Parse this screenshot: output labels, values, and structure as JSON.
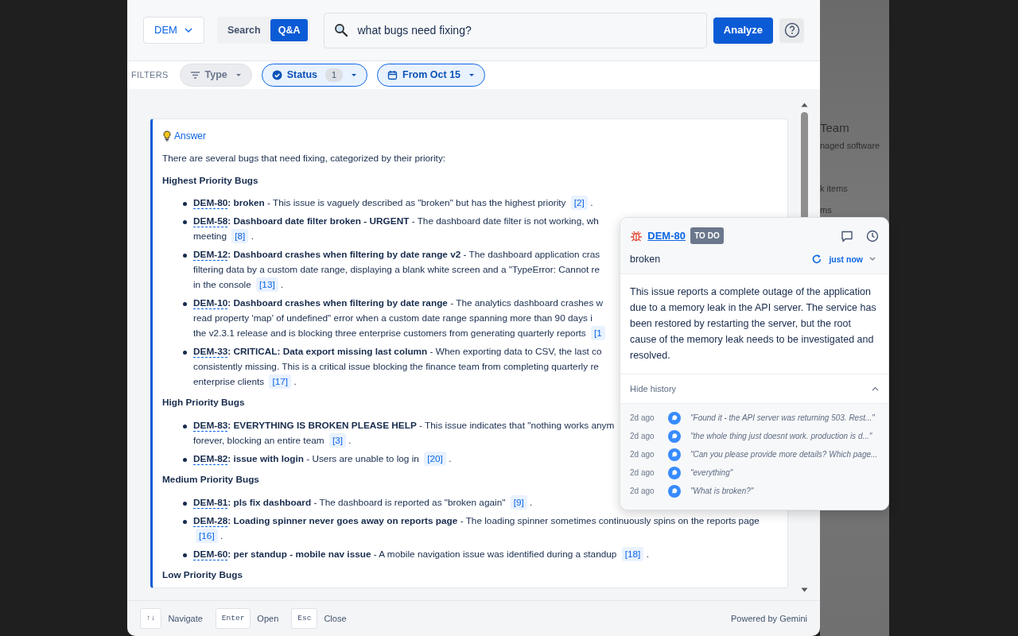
{
  "header": {
    "project": "DEM",
    "modes": [
      {
        "label": "Search",
        "selected": false
      },
      {
        "label": "Q&A",
        "selected": true
      }
    ],
    "query": "what bugs need fixing?",
    "analyze": "Analyze"
  },
  "filters": {
    "label": "FILTERS",
    "chips": [
      {
        "label": "Type",
        "active": false,
        "kind": "type"
      },
      {
        "label": "Status",
        "active": true,
        "kind": "status",
        "count": "1"
      },
      {
        "label": "From Oct 15",
        "active": true,
        "kind": "date"
      }
    ]
  },
  "answer": {
    "title": "Answer",
    "intro": "There are several bugs that need fixing, categorized by their priority:",
    "sections": [
      {
        "heading": "Highest Priority Bugs",
        "items": [
          {
            "id": "DEM-80",
            "title": ": broken",
            "lines": [
              "- This issue is vaguely described as \"broken\" but has the highest priority"
            ],
            "ref": "[2]",
            "end": "."
          },
          {
            "id": "DEM-58",
            "title": ": Dashboard date filter broken - URGENT",
            "lines": [
              "- The dashboard date filter is not working, wh",
              "meeting"
            ],
            "ref": "[8]",
            "end": "."
          },
          {
            "id": "DEM-12",
            "title": ": Dashboard crashes when filtering by date range v2",
            "lines": [
              "- The dashboard application cras",
              "filtering data by a custom date range, displaying a blank white screen and a \"TypeError: Cannot re",
              "in the console"
            ],
            "ref": "[13]",
            "end": "."
          },
          {
            "id": "DEM-10",
            "title": ": Dashboard crashes when filtering by date range",
            "lines": [
              "- The analytics dashboard crashes w",
              "read property 'map' of undefined\" error when a custom date range spanning more than 90 days i",
              "the v2.3.1 release and is blocking three enterprise customers from generating quarterly reports"
            ],
            "ref": "[1"
          },
          {
            "id": "DEM-33",
            "title": ": CRITICAL: Data export missing last column",
            "lines": [
              "- When exporting data to CSV, the last co",
              "consistently missing. This is a critical issue blocking the finance team from completing quarterly re",
              "enterprise clients"
            ],
            "ref": "[17]",
            "end": "."
          }
        ]
      },
      {
        "heading": "High Priority Bugs",
        "items": [
          {
            "id": "DEM-83",
            "title": ": EVERYTHING IS BROKEN PLEASE HELP",
            "lines": [
              "- This issue indicates that \"nothing works anym",
              "forever, blocking an entire team"
            ],
            "ref": "[3]",
            "end": "."
          },
          {
            "id": "DEM-82",
            "title": ": issue with login",
            "lines": [
              "- Users are unable to log in"
            ],
            "ref": "[20]",
            "end": "."
          }
        ]
      },
      {
        "heading": "Medium Priority Bugs",
        "items": [
          {
            "id": "DEM-81",
            "title": ": pls fix dashboard",
            "lines": [
              "- The dashboard is reported as \"broken again\""
            ],
            "ref": "[9]",
            "end": "."
          },
          {
            "id": "DEM-28",
            "title": ": Loading spinner never goes away on reports page",
            "lines": [
              "- The loading spinner sometimes continuously spins on the reports page"
            ],
            "ref": "[16]",
            "end": "."
          },
          {
            "id": "DEM-60",
            "title": ": per standup - mobile nav issue",
            "lines": [
              "- A mobile navigation issue was identified during a standup"
            ],
            "ref": "[18]",
            "end": "."
          }
        ]
      },
      {
        "heading": "Low Priority Bugs"
      }
    ]
  },
  "popover": {
    "key": "DEM-80",
    "status": "TO DO",
    "summary": "broken",
    "updated": "just now",
    "description": "This issue reports a complete outage of the application due to a memory leak in the API server. The service has been restored by restarting the server, but the root cause of the memory leak needs to be investigated and resolved.",
    "history_toggle": "Hide history",
    "expanded": true,
    "history": [
      {
        "time": "2d ago",
        "text": "\"Found it - the API server was returning 503. Rest...\""
      },
      {
        "time": "2d ago",
        "text": "\"the whole thing just doesnt work. production is d...\""
      },
      {
        "time": "2d ago",
        "text": "\"Can you please provide more details? Which page..."
      },
      {
        "time": "2d ago",
        "text": "\"everything\""
      },
      {
        "time": "2d ago",
        "text": "\"What is broken?\""
      }
    ]
  },
  "footer": {
    "hints": [
      {
        "key": "↑↓",
        "label": "Navigate"
      },
      {
        "key": "Enter",
        "label": "Open"
      },
      {
        "key": "Esc",
        "label": "Close"
      }
    ],
    "powered": "Powered by Gemini"
  },
  "background": {
    "texts": [
      "Team",
      "naged software",
      "k items",
      "ms"
    ]
  }
}
